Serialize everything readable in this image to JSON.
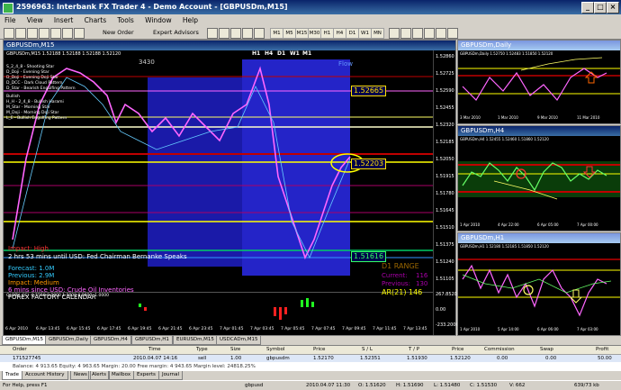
{
  "app": {
    "title": "2596963: Interbank FX Trader 4 - Demo Account - [GBPUSDm,M15]",
    "minimize": "_",
    "maximize": "□",
    "close": "×"
  },
  "menu": [
    "File",
    "View",
    "Insert",
    "Charts",
    "Tools",
    "Window",
    "Help"
  ],
  "toolbar": {
    "new_order": "New Order",
    "expert_advisors": "Expert Advisors",
    "timeframes": [
      "M1",
      "M5",
      "M15",
      "M30",
      "H1",
      "H4",
      "D1",
      "W1",
      "MN"
    ]
  },
  "main_chart": {
    "title": "GBPUSDm,M15",
    "ohlc": "GBPUSDm,M15  1.52188 1.52188 1.52188 1.52120",
    "top_labels": [
      "H1",
      "H4",
      "D1",
      "W1",
      "M1"
    ],
    "header_number": "3430",
    "flow_label": "Flow",
    "price_box_1": "1.52665",
    "price_box_2": "1.52203",
    "price_box_3": "1.51616",
    "legend_lines": [
      "S_2_4_8 - Shooting Star",
      "D_Doji - Evening Star",
      "D_Doji - Evening Doji Star",
      "D_DCC - Dark Cloud Pattern",
      "D_Star - Bearish Engulfing Pattern",
      "Bullish",
      "H_H - 2_4_8 - Bullish Harami",
      "M_Star - Morning Star",
      "M_Doji - Morning Doji Star",
      "L_E - Bullish Engulfing Pattern"
    ],
    "news_1": "Impact: High",
    "news_2": "2 hrs 53 mins until USD: Fed Chairman Bernanke Speaks",
    "forecast": "Forecast: 1.0M",
    "previous": "Previous: 2.9M",
    "impact_medium": "Impact: Medium",
    "news_3": "6 mins since USD: Crude Oil Inventories",
    "calendar": "FOREX FACTORY CALENDAR",
    "d1_range": "D1 RANGE",
    "current_label": "Current:",
    "current_val": "116",
    "previous_label": "Previous:",
    "previous_val": "130",
    "ar_label": "AR(21) 146",
    "indicator_label": "QLORY_CCI -0.5558 0.0000 1.0000 0.0000 -1.0000",
    "axis_prices": [
      "1.52860",
      "1.52725",
      "1.52590",
      "1.52455",
      "1.52320",
      "1.52185",
      "1.52050",
      "1.51915",
      "1.51780",
      "1.51645",
      "1.51510",
      "1.51375",
      "1.51240",
      "1.51105"
    ],
    "time_labels": [
      "6 Apr 2010",
      "6 Apr 13:45",
      "6 Apr 15:45",
      "6 Apr 17:45",
      "6 Apr 19:45",
      "6 Apr 21:45",
      "6 Apr 23:45",
      "7 Apr 01:45",
      "7 Apr 03:45",
      "7 Apr 05:45",
      "7 Apr 07:45",
      "7 Apr 09:45",
      "7 Apr 11:45",
      "7 Apr 13:45"
    ],
    "indicator_axis": [
      "267.8520",
      "0.00",
      "-233.2006"
    ]
  },
  "side_charts": [
    {
      "title": "GBPUSDm,Daily",
      "ohlc": "GBPUSDm,Daily  1.52750 1.52483 1.51850 1.52120",
      "times": [
        "3 Mar 2010",
        "1 Mar 2010",
        "9 Mar 2010",
        "11 Mar 2010"
      ]
    },
    {
      "title": "GBPUSDm,H4",
      "ohlc": "GBPUSDm,H4  1.52455 1.52460 1.51860 1.52120",
      "times": [
        "1 Apr 2010",
        "4 Apr 22:00",
        "6 Apr 05:00",
        "7 Apr 00:00"
      ]
    },
    {
      "title": "GBPUSDm,H1",
      "ohlc": "GBPUSDm,H1  1.52180 1.52185 1.51850 1.52120",
      "times": [
        "1 Apr 2010",
        "5 Apr 14:00",
        "6 Apr 06:00",
        "7 Apr 03:00"
      ]
    }
  ],
  "chart_tabs": [
    "GBPUSDm,M15",
    "GBPUSDm,Daily",
    "GBPUSDm,H4",
    "GBPUSDm,H1",
    "EURUSDm,M15",
    "USDCADm,M15"
  ],
  "terminal": {
    "columns": [
      "Order",
      "Time",
      "Type",
      "Size",
      "Symbol",
      "Price",
      "S / L",
      "T / P",
      "Price",
      "Commission",
      "Swap",
      "Profit"
    ],
    "row": [
      "171527745",
      "2010.04.07 14:16",
      "sell",
      "1.00",
      "gbpusdm",
      "1.52170",
      "1.52351",
      "1.51930",
      "1.52120",
      "0.00",
      "0.00",
      "50.00"
    ],
    "balance": "Balance: 4 913.65  Equity: 4 963.65  Margin: 20.00  Free margin: 4 943.65  Margin level: 24818.25%",
    "tabs": [
      "Trade",
      "Account History",
      "News",
      "Alerts",
      "Mailbox",
      "Experts",
      "Journal"
    ]
  },
  "status": {
    "help": "For Help, press F1",
    "profile": "gbpusd",
    "datetime": "2010.04.07 11:30",
    "o": "O: 1.51620",
    "h": "H: 1.51690",
    "l": "L: 1.51480",
    "c": "C: 1.51530",
    "v": "V: 662",
    "kb": "639/73 kb"
  }
}
